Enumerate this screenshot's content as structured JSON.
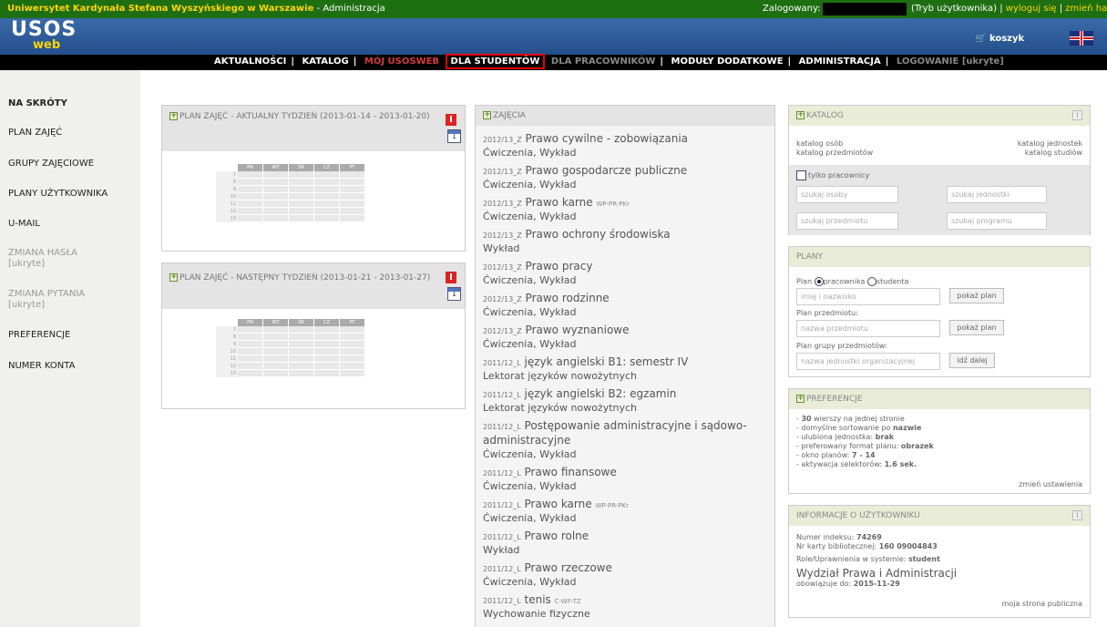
{
  "topbar": {
    "org": "Uniwersytet Kardynała Stefana Wyszyńskiego w Warszawie",
    "admin": " - Administracja",
    "logged": "Zalogowany:",
    "mode": "(Tryb użytkownika) | ",
    "logout": "wyloguj się",
    "sep": " | ",
    "change_password": "zmień hasło"
  },
  "header": {
    "logo": "USOS",
    "logo_sub": "web",
    "cart": "koszyk"
  },
  "menu": {
    "news": "AKTUALNOŚCI",
    "catalog": "KATALOG",
    "my": "MÓJ USOSWEB",
    "students": "DLA STUDENTÓW",
    "staff": "DLA PRACOWNIKÓW",
    "modules": "MODUŁY DODATKOWE",
    "admin": "ADMINISTRACJA",
    "login": "LOGOWANIE [ukryte]"
  },
  "sidebar": {
    "shortcuts": "NA SKRÓTY",
    "plan": "PLAN ZAJĘĆ",
    "groups": "GRUPY ZAJĘCIOWE",
    "user_plans": "PLANY UŻYTKOWNIKA",
    "umail": "U-MAIL",
    "change_pw": "ZMIANA HASŁA",
    "change_pw_sub": "[ukryte]",
    "change_q": "ZMIANA PYTANIA",
    "change_q_sub": "[ukryte]",
    "prefs": "PREFERENCJE",
    "account": "NUMER KONTA"
  },
  "plans": {
    "this_week": "PLAN ZAJĘĆ - AKTUALNY TYDZIEŃ (2013-01-14 - 2013-01-20)",
    "next_week": "PLAN ZAJĘĆ - NASTĘPNY TYDZIEŃ (2013-01-21 - 2013-01-27)",
    "days": [
      "PN",
      "WT",
      "ŚR",
      "CZ",
      "PT"
    ],
    "hours": [
      "7",
      "8",
      "9",
      "10",
      "11",
      "12",
      "13"
    ],
    "cal_day": "1"
  },
  "zajecia": {
    "title": "ZAJĘCIA",
    "courses": [
      {
        "term": "2012/13_Z",
        "name": "Prawo cywilne - zobowiązania",
        "code": "",
        "sub": "Ćwiczenia, Wykład"
      },
      {
        "term": "2012/13_Z",
        "name": "Prawo gospodarcze publiczne",
        "code": "",
        "sub": "Ćwiczenia, Wykład"
      },
      {
        "term": "2012/13_Z",
        "name": "Prawo karne",
        "code": "WP-PR-PKr",
        "sub": "Ćwiczenia, Wykład"
      },
      {
        "term": "2012/13_Z",
        "name": "Prawo ochrony środowiska",
        "code": "",
        "sub": "Wykład"
      },
      {
        "term": "2012/13_Z",
        "name": "Prawo pracy",
        "code": "",
        "sub": "Ćwiczenia, Wykład"
      },
      {
        "term": "2012/13_Z",
        "name": "Prawo rodzinne",
        "code": "",
        "sub": "Ćwiczenia, Wykład"
      },
      {
        "term": "2012/13_Z",
        "name": "Prawo wyznaniowe",
        "code": "",
        "sub": "Ćwiczenia, Wykład"
      },
      {
        "term": "2011/12_L",
        "name": "język angielski B1: semestr IV",
        "code": "",
        "sub": "Lektorat języków nowożytnych"
      },
      {
        "term": "2011/12_L",
        "name": "język angielski B2: egzamin",
        "code": "",
        "sub": "Lektorat języków nowożytnych"
      },
      {
        "term": "2011/12_L",
        "name": "Postępowanie administracyjne i sądowo-administracyjne",
        "code": "",
        "sub": "Ćwiczenia, Wykład"
      },
      {
        "term": "2011/12_L",
        "name": "Prawo finansowe",
        "code": "",
        "sub": "Ćwiczenia, Wykład"
      },
      {
        "term": "2011/12_L",
        "name": "Prawo karne",
        "code": "WP-PR-PKr",
        "sub": "Ćwiczenia, Wykład"
      },
      {
        "term": "2011/12_L",
        "name": "Prawo rolne",
        "code": "",
        "sub": "Wykład"
      },
      {
        "term": "2011/12_L",
        "name": "Prawo rzeczowe",
        "code": "",
        "sub": "Ćwiczenia, Wykład"
      },
      {
        "term": "2011/12_L",
        "name": "tenis",
        "code": "C-WF-TZ",
        "sub": "Wychowanie fizyczne"
      }
    ]
  },
  "katalog": {
    "title": "KATALOG",
    "persons": "katalog osób",
    "subjects": "katalog przedmiotów",
    "units": "katalog jednostek",
    "studies": "katalog studiów",
    "only_staff": "tylko pracownicy",
    "search_person": "szukaj osoby",
    "search_unit": "szukaj jednostki",
    "search_subject": "szukaj przedmiotu",
    "search_program": "szukaj programu"
  },
  "plany": {
    "title": "PLANY",
    "plan": "Plan",
    "staff": "pracownika",
    "student": "studenta",
    "name_ph": "imię i nazwisko",
    "show": "pokaż plan",
    "subject_plan": "Plan przedmiotu:",
    "subject_ph": "nazwa przedmiotu",
    "group_plan": "Plan grupy przedmiotów:",
    "unit_ph": "nazwa jednostki organizacyjnej",
    "go": "idź dalej"
  },
  "prefs": {
    "title": "PREFERENCJE",
    "l1a": "- ",
    "l1b": "30",
    "l1c": " wierszy na jednej stronie",
    "l2a": "- domyślne sortowanie po ",
    "l2b": "nazwie",
    "l3a": "- ulubiona jednostka: ",
    "l3b": "brak",
    "l4a": "- preferowany format planu: ",
    "l4b": "obrazek",
    "l5a": "- okno planów: ",
    "l5b": "7 - 14",
    "l6a": "- aktywacja selektorów: ",
    "l6b": "1.6 sek.",
    "change": "zmień ustawienia"
  },
  "userinfo": {
    "title": "INFORMACJE O UŻYTKOWNIKU",
    "index_l": "Numer indeksu: ",
    "index": "74269",
    "card_l": "Nr karty bibliotecznej: ",
    "card": "160 09004843",
    "role_l": "Role/Uprawnienia w systemie: ",
    "role": "student",
    "faculty": "Wydział Prawa i Administracji",
    "valid_l": "obowiązuje do: ",
    "valid": "2015-11-29",
    "public": "moja strona publiczna"
  }
}
